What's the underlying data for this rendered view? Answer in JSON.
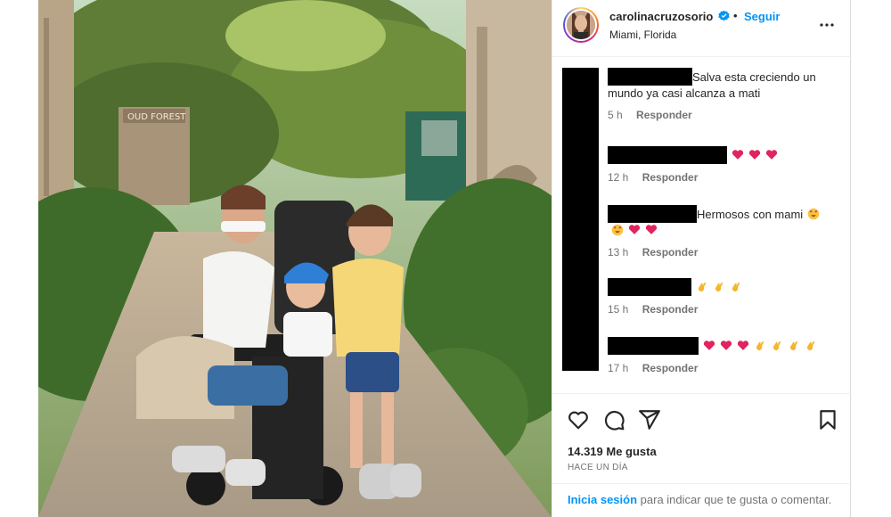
{
  "header": {
    "username": "carolinacruzosorio",
    "separator": "•",
    "follow_label": "Seguir",
    "location": "Miami, Florida"
  },
  "photo": {
    "sign_text": "OUD FOREST"
  },
  "comments": [
    {
      "text": "Salva esta creciendo un mundo ya casi alcanza a mati",
      "emojis": [],
      "time": "5 h",
      "reply_label": "Responder"
    },
    {
      "text": "",
      "emojis": [
        "heart",
        "heart",
        "heart"
      ],
      "time": "12 h",
      "reply_label": "Responder"
    },
    {
      "text": "Hermosos con mami",
      "emojis": [
        "heart-eyes"
      ],
      "second_line_emojis": [
        "heart-eyes",
        "heart",
        "heart"
      ],
      "time": "13 h",
      "reply_label": "Responder"
    },
    {
      "text": "",
      "emojis": [
        "clap",
        "clap",
        "clap"
      ],
      "time": "15 h",
      "reply_label": "Responder"
    },
    {
      "text": "",
      "emojis": [
        "heart",
        "heart",
        "heart",
        "clap",
        "clap",
        "clap",
        "clap"
      ],
      "time": "17 h",
      "reply_label": "Responder"
    }
  ],
  "actions": {
    "like_icon": "heart-outline-icon",
    "comment_icon": "comment-icon",
    "share_icon": "share-icon",
    "save_icon": "bookmark-icon"
  },
  "stats": {
    "likes": "14.319 Me gusta",
    "date": "HACE UN DÍA"
  },
  "login": {
    "link": "Inicia sesión",
    "text": " para indicar que te gusta o comentar."
  },
  "colors": {
    "accent": "#0095f6",
    "text": "#262626",
    "secondary": "#737373",
    "heart": "#e0245e"
  }
}
